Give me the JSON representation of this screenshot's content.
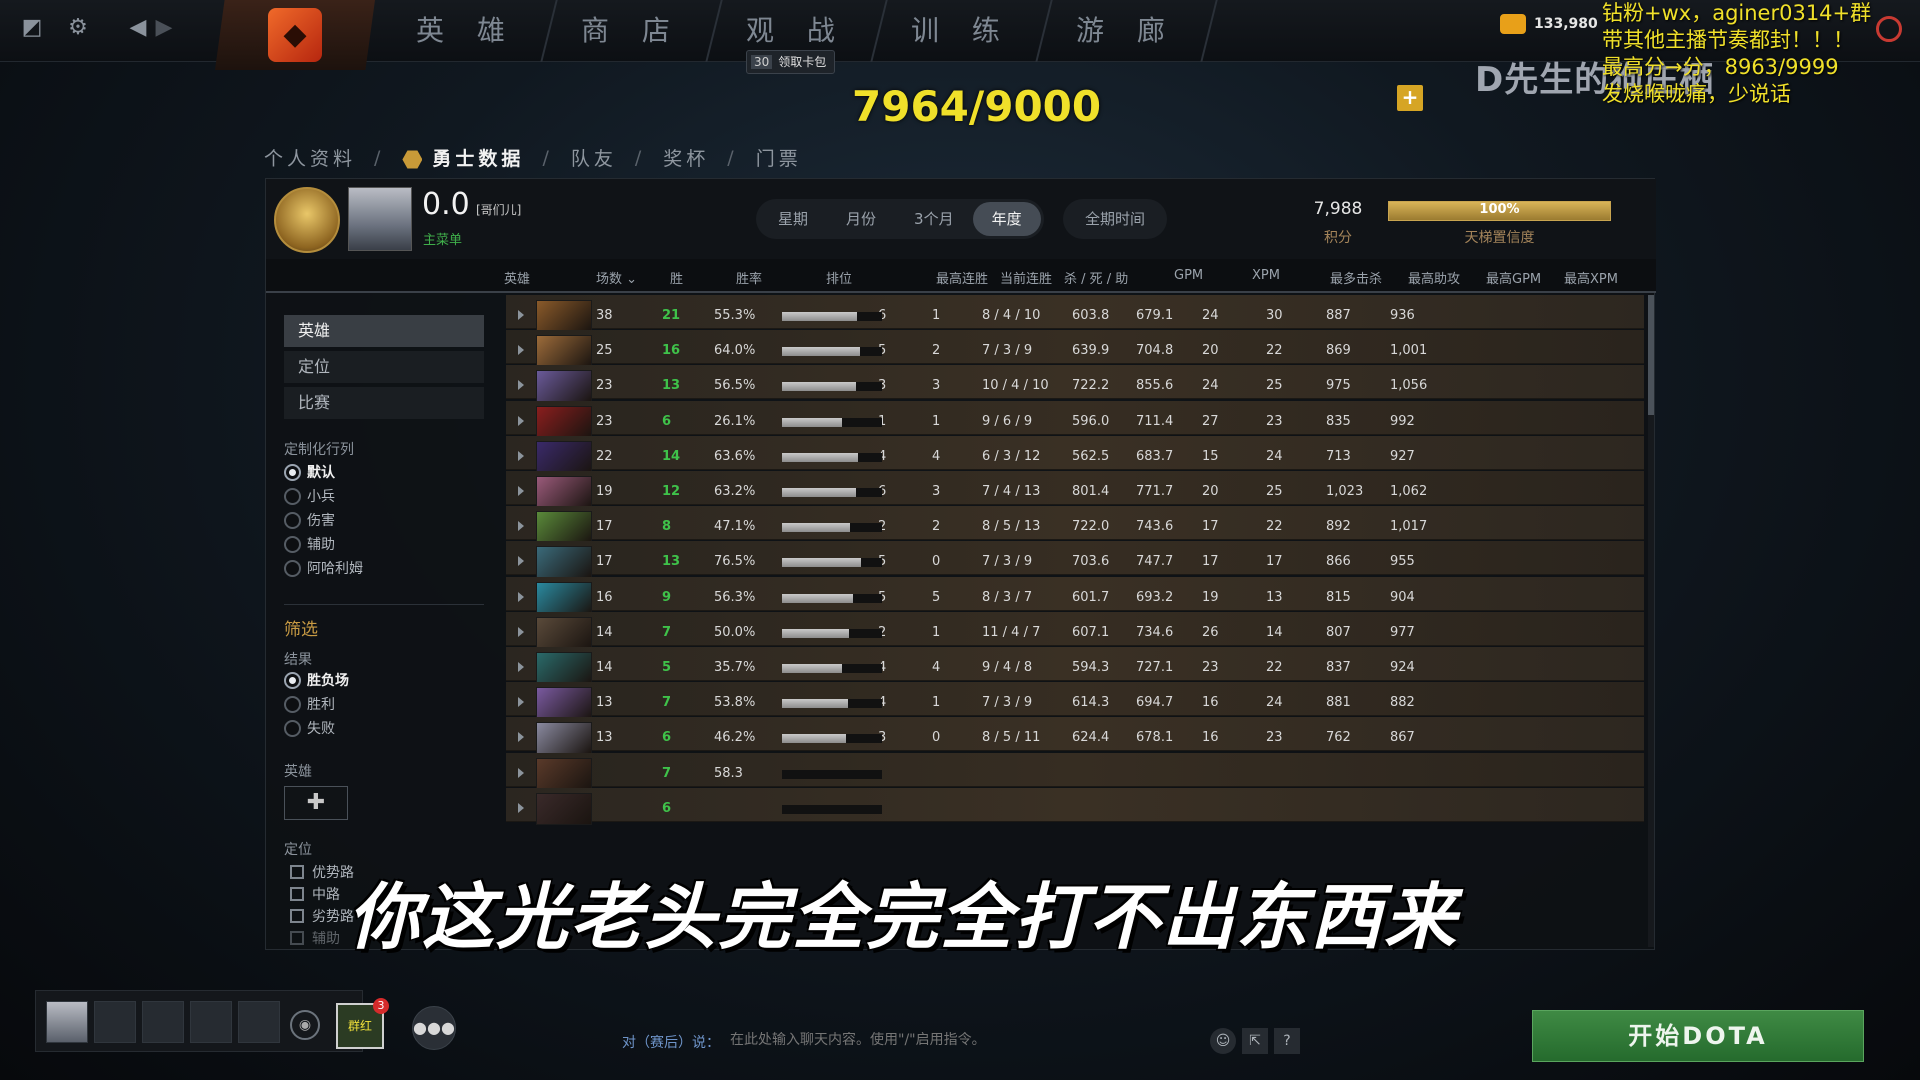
{
  "nav": {
    "tabs": [
      "英 雄",
      "商 店",
      "观 战",
      "训 练",
      "游 廊"
    ],
    "card_pack_count": "30",
    "card_pack_label": "领取卡包",
    "coins": "133,980"
  },
  "overlay": {
    "counter": "7964/9000",
    "watermark": "D先生的狗庄栖",
    "ticker": [
      "钻粉+wx，aginer0314+群",
      "带其他主播节奏都封！！！",
      "最高分→分，8963/9999",
      "发烧喉咙痛，少说话"
    ],
    "subtitle": "你这光老头完全完全打不出东西来"
  },
  "breadcrumb": [
    "个人资料",
    "勇士数据",
    "队友",
    "奖杯",
    "门票"
  ],
  "profile": {
    "score": "0.0",
    "tag": "[哥们儿]",
    "main_list": "主菜单",
    "points": "7,988",
    "points_label": "积分",
    "confidence_value": 100,
    "confidence": "100%",
    "confidence_label": "天梯置信度"
  },
  "periods": [
    "星期",
    "月份",
    "3个月",
    "年度"
  ],
  "period_all": "全期时间",
  "period_selected": "年度",
  "columns": [
    "英雄",
    "场数",
    "胜",
    "胜率",
    "排位",
    "最高连胜",
    "当前连胜",
    "杀 / 死 / 助",
    "GPM",
    "XPM",
    "最多击杀",
    "最高助攻",
    "最高GPM",
    "最高XPM"
  ],
  "sidebar": {
    "tabs": [
      "英雄",
      "定位",
      "比赛"
    ],
    "custom_heading": "定制化行列",
    "custom_options": [
      "默认",
      "小兵",
      "伤害",
      "辅助",
      "阿哈利姆"
    ],
    "filter_heading": "筛选",
    "result_heading": "结果",
    "result_options": [
      "胜负场",
      "胜利",
      "失败"
    ],
    "hero_heading": "英雄",
    "role_heading": "定位",
    "role_options": [
      "优势路",
      "中路",
      "劣势路",
      "辅助"
    ]
  },
  "rows": [
    {
      "games": "38",
      "wins": "21",
      "winrate": "55.3%",
      "rank": 0.75,
      "max_streak": "6",
      "cur_streak": "1",
      "kda": "8 / 4 / 10",
      "gpm": "603.8",
      "xpm": "679.1",
      "max_kills": "24",
      "max_assists": "30",
      "max_gpm": "887",
      "max_xpm": "936",
      "color": "#8a5a2a"
    },
    {
      "games": "25",
      "wins": "16",
      "winrate": "64.0%",
      "rank": 0.78,
      "max_streak": "5",
      "cur_streak": "2",
      "kda": "7 / 3 / 9",
      "gpm": "639.9",
      "xpm": "704.8",
      "max_kills": "20",
      "max_assists": "22",
      "max_gpm": "869",
      "max_xpm": "1,001",
      "color": "#9c6b3a"
    },
    {
      "games": "23",
      "wins": "13",
      "winrate": "56.5%",
      "rank": 0.74,
      "max_streak": "3",
      "cur_streak": "3",
      "kda": "10 / 4 / 10",
      "gpm": "722.2",
      "xpm": "855.6",
      "max_kills": "24",
      "max_assists": "25",
      "max_gpm": "975",
      "max_xpm": "1,056",
      "color": "#6a5a9a"
    },
    {
      "games": "23",
      "wins": "6",
      "winrate": "26.1%",
      "rank": 0.6,
      "max_streak": "1",
      "cur_streak": "1",
      "kda": "9 / 6 / 9",
      "gpm": "596.0",
      "xpm": "711.4",
      "max_kills": "27",
      "max_assists": "23",
      "max_gpm": "835",
      "max_xpm": "992",
      "color": "#8a1e1e"
    },
    {
      "games": "22",
      "wins": "14",
      "winrate": "63.6%",
      "rank": 0.76,
      "max_streak": "4",
      "cur_streak": "4",
      "kda": "6 / 3 / 12",
      "gpm": "562.5",
      "xpm": "683.7",
      "max_kills": "15",
      "max_assists": "24",
      "max_gpm": "713",
      "max_xpm": "927",
      "color": "#3a2a6a"
    },
    {
      "games": "19",
      "wins": "12",
      "winrate": "63.2%",
      "rank": 0.74,
      "max_streak": "6",
      "cur_streak": "3",
      "kda": "7 / 4 / 13",
      "gpm": "801.4",
      "xpm": "771.7",
      "max_kills": "20",
      "max_assists": "25",
      "max_gpm": "1,023",
      "max_xpm": "1,062",
      "color": "#9a5a7a"
    },
    {
      "games": "17",
      "wins": "8",
      "winrate": "47.1%",
      "rank": 0.68,
      "max_streak": "2",
      "cur_streak": "2",
      "kda": "8 / 5 / 13",
      "gpm": "722.0",
      "xpm": "743.6",
      "max_kills": "17",
      "max_assists": "22",
      "max_gpm": "892",
      "max_xpm": "1,017",
      "color": "#5a8a3a"
    },
    {
      "games": "17",
      "wins": "13",
      "winrate": "76.5%",
      "rank": 0.79,
      "max_streak": "5",
      "cur_streak": "0",
      "kda": "7 / 3 / 9",
      "gpm": "703.6",
      "xpm": "747.7",
      "max_kills": "17",
      "max_assists": "17",
      "max_gpm": "866",
      "max_xpm": "955",
      "color": "#3a6a7a"
    },
    {
      "games": "16",
      "wins": "9",
      "winrate": "56.3%",
      "rank": 0.71,
      "max_streak": "5",
      "cur_streak": "5",
      "kda": "8 / 3 / 7",
      "gpm": "601.7",
      "xpm": "693.2",
      "max_kills": "19",
      "max_assists": "13",
      "max_gpm": "815",
      "max_xpm": "904",
      "color": "#2a8aa0"
    },
    {
      "games": "14",
      "wins": "7",
      "winrate": "50.0%",
      "rank": 0.67,
      "max_streak": "2",
      "cur_streak": "1",
      "kda": "11 / 4 / 7",
      "gpm": "607.1",
      "xpm": "734.6",
      "max_kills": "26",
      "max_assists": "14",
      "max_gpm": "807",
      "max_xpm": "977",
      "color": "#5a4a3a"
    },
    {
      "games": "14",
      "wins": "5",
      "winrate": "35.7%",
      "rank": 0.6,
      "max_streak": "4",
      "cur_streak": "4",
      "kda": "9 / 4 / 8",
      "gpm": "594.3",
      "xpm": "727.1",
      "max_kills": "23",
      "max_assists": "22",
      "max_gpm": "837",
      "max_xpm": "924",
      "color": "#2a6a6a"
    },
    {
      "games": "13",
      "wins": "7",
      "winrate": "53.8%",
      "rank": 0.66,
      "max_streak": "4",
      "cur_streak": "1",
      "kda": "7 / 3 / 9",
      "gpm": "614.3",
      "xpm": "694.7",
      "max_kills": "16",
      "max_assists": "24",
      "max_gpm": "881",
      "max_xpm": "882",
      "color": "#7a5aa0"
    },
    {
      "games": "13",
      "wins": "6",
      "winrate": "46.2%",
      "rank": 0.64,
      "max_streak": "3",
      "cur_streak": "0",
      "kda": "8 / 5 / 11",
      "gpm": "624.4",
      "xpm": "678.1",
      "max_kills": "16",
      "max_assists": "23",
      "max_gpm": "762",
      "max_xpm": "867",
      "color": "#8a8aa0"
    },
    {
      "games": "",
      "wins": "7",
      "winrate": "58.3",
      "rank": 0.0,
      "max_streak": "",
      "cur_streak": "",
      "kda": "",
      "gpm": "",
      "xpm": "",
      "max_kills": "",
      "max_assists": "",
      "max_gpm": "",
      "max_xpm": "",
      "color": "#5a3a2a"
    },
    {
      "games": "",
      "wins": "6",
      "winrate": "",
      "rank": 0.0,
      "max_streak": "",
      "cur_streak": "",
      "kda": "",
      "gpm": "",
      "xpm": "",
      "max_kills": "",
      "max_assists": "",
      "max_gpm": "",
      "max_xpm": "",
      "color": "#3a2a2a"
    }
  ],
  "bottom": {
    "pack_label": "群红",
    "pack_badge": "3",
    "chat_target": "对（赛后）说：",
    "chat_placeholder": "在此处输入聊天内容。使用\"/\"启用指令。",
    "start": "开始DOTA"
  },
  "colors": {
    "accent_gold": "#c79a43",
    "win_green": "#3fc24a",
    "start_green": "#3f8a44",
    "counter_yellow": "#f0e02a"
  }
}
